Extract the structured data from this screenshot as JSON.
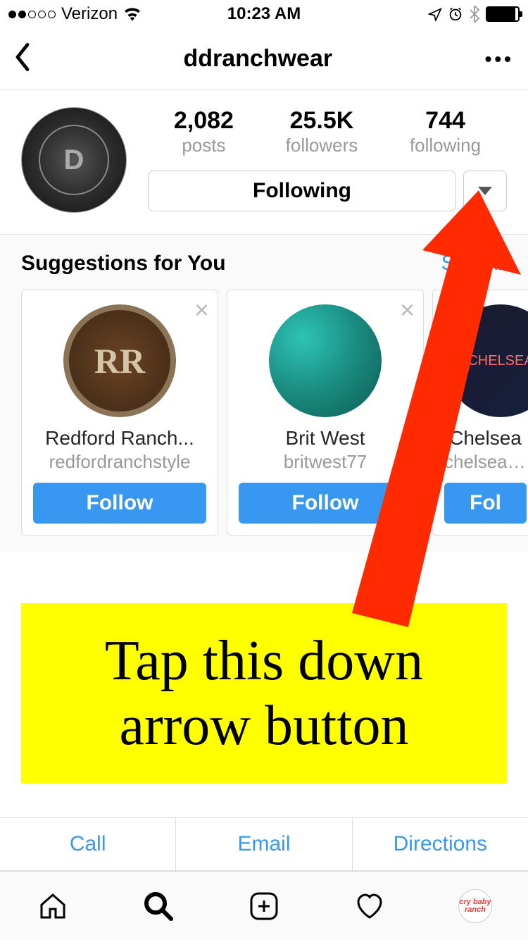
{
  "status": {
    "carrier": "Verizon",
    "time": "10:23 AM"
  },
  "nav": {
    "title": "ddranchwear"
  },
  "profile": {
    "avatar_text": "D",
    "stats": {
      "posts_count": "2,082",
      "posts_label": "posts",
      "followers_count": "25.5K",
      "followers_label": "followers",
      "following_count": "744",
      "following_label": "following"
    },
    "following_button": "Following"
  },
  "suggestions": {
    "title": "Suggestions for You",
    "see_all": "See All",
    "cards": [
      {
        "name": "Redford Ranch...",
        "username": "redfordranchstyle",
        "follow": "Follow",
        "avatar_text": "RR"
      },
      {
        "name": "Brit West",
        "username": "britwest77",
        "follow": "Follow",
        "avatar_text": ""
      },
      {
        "name": "Chelsea",
        "username": "chelseaco",
        "follow": "Fol",
        "avatar_text": "CHELSEA"
      }
    ]
  },
  "annotation": {
    "text": "Tap this down arrow button"
  },
  "contact": {
    "call": "Call",
    "email": "Email",
    "directions": "Directions"
  },
  "tabbar": {
    "profile_text": "cry baby ranch"
  }
}
